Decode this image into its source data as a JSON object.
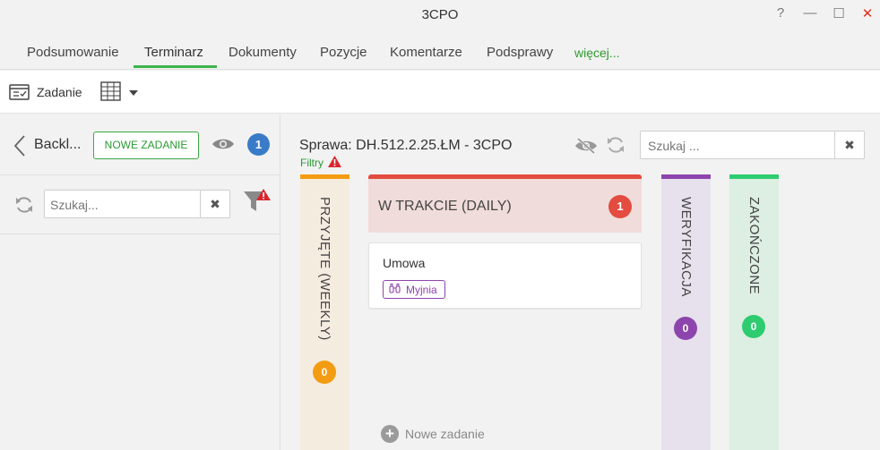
{
  "window": {
    "title": "3CPO",
    "help": "?",
    "minimize": "—",
    "maximize": "☐",
    "close": "✕",
    "close_color": "#e0321e"
  },
  "tabs": [
    {
      "label": "Podsumowanie"
    },
    {
      "label": "Terminarz",
      "active": true
    },
    {
      "label": "Dokumenty"
    },
    {
      "label": "Pozycje"
    },
    {
      "label": "Komentarze"
    },
    {
      "label": "Podsprawy"
    },
    {
      "label": "więcej..."
    }
  ],
  "toolbar": {
    "task_label": "Zadanie",
    "task_icon": "task-list-icon",
    "grid_icon": "grid-icon"
  },
  "left_panel": {
    "back_label": "Backl...",
    "new_task_button": "NOWE ZADANIE",
    "visible_count": "1",
    "search_placeholder": "Szukaj...",
    "clear_symbol": "✖"
  },
  "main": {
    "case_title": "Sprawa: DH.512.2.25.ŁM - 3CPO",
    "filters_label": "Filtry",
    "search_placeholder": "Szukaj ...",
    "clear_symbol": "✖"
  },
  "columns": [
    {
      "title": "PRZYJĘTE (WEEKLY)",
      "count": "0",
      "color": "#f39c12",
      "bg": "#f5ece0"
    },
    {
      "title": "W TRAKCIE (DAILY)",
      "count": "1",
      "color": "#e34c3f",
      "bg": "#f0dcda"
    },
    {
      "title": "WERYFIKACJA",
      "count": "0",
      "color": "#8e44ad",
      "bg": "#e6e1ec"
    },
    {
      "title": "ZAKOŃCZONE",
      "count": "0",
      "color": "#2ecc71",
      "bg": "#ddeee2"
    }
  ],
  "card": {
    "title": "Umowa",
    "tag": "Myjnia",
    "tag_color": "#8e44ad"
  },
  "new_task_link": "Nowe zadanie"
}
